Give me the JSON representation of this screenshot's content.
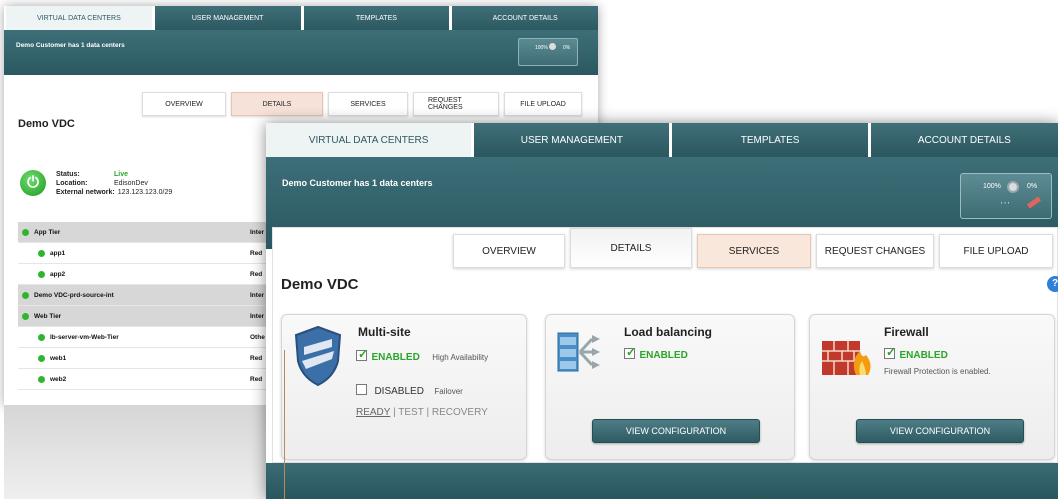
{
  "back_window": {
    "tabs": [
      "VIRTUAL DATA CENTERS",
      "USER MANAGEMENT",
      "TEMPLATES",
      "ACCOUNT DETAILS"
    ],
    "banner_message": "Demo Customer has 1 data centers",
    "zoom": {
      "max_label": "100%",
      "min_label": "0%"
    },
    "subtabs": [
      "OVERVIEW",
      "DETAILS",
      "SERVICES",
      "REQUEST CHANGES",
      "FILE UPLOAD"
    ],
    "title": "Demo VDC",
    "status": {
      "status_label": "Status:",
      "status_value": "Live",
      "location_label": "Location:",
      "location_value": "EdisonDev",
      "network_label": "External network:",
      "network_value": "123.123.123.0/29"
    },
    "list": [
      {
        "name": "App Tier",
        "right": "Inter",
        "group": true
      },
      {
        "name": "app1",
        "right": "Red",
        "group": false
      },
      {
        "name": "app2",
        "right": "Red",
        "group": false
      },
      {
        "name": "Demo VDC-prd-source-int",
        "right": "Inter",
        "group": true
      },
      {
        "name": "Web Tier",
        "right": "Inter",
        "group": true
      },
      {
        "name": "lb-server-vm-Web-Tier",
        "right": "Othe",
        "group": false
      },
      {
        "name": "web1",
        "right": "Red",
        "group": false
      },
      {
        "name": "web2",
        "right": "Red",
        "group": false
      }
    ]
  },
  "front_window": {
    "tabs": [
      "VIRTUAL DATA CENTERS",
      "USER MANAGEMENT",
      "TEMPLATES",
      "ACCOUNT DETAILS"
    ],
    "banner_message": "Demo Customer has 1 data centers",
    "zoom": {
      "max_label": "100%",
      "min_label": "0%"
    },
    "subtabs": [
      "OVERVIEW",
      "DETAILS",
      "SERVICES",
      "REQUEST CHANGES",
      "FILE UPLOAD"
    ],
    "title": "Demo VDC",
    "help": "?",
    "multisite": {
      "title": "Multi-site",
      "enabled_label": "ENABLED",
      "enabled_desc": "High Availability",
      "disabled_label": "DISABLED",
      "disabled_desc": "Failover",
      "ready": "READY",
      "sep1": "|",
      "test": "TEST",
      "sep2": "|",
      "recovery": "RECOVERY"
    },
    "load_balancing": {
      "title": "Load balancing",
      "enabled_label": "ENABLED",
      "button": "VIEW CONFIGURATION"
    },
    "firewall": {
      "title": "Firewall",
      "enabled_label": "ENABLED",
      "desc": "Firewall Protection is enabled.",
      "button": "VIEW CONFIGURATION"
    }
  },
  "colors": {
    "teal": "#2d5961",
    "enabled_green": "#2aa52a",
    "active_subtab": "#f9e7dc"
  }
}
